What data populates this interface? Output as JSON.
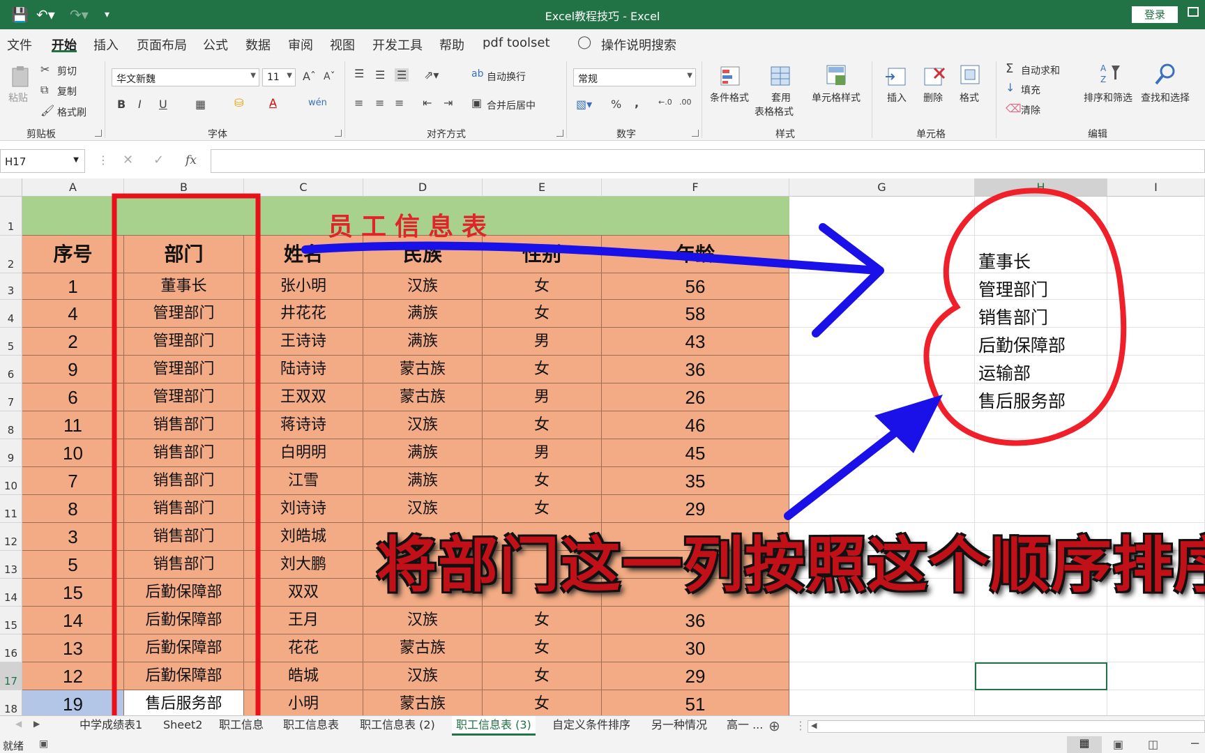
{
  "titlebar": {
    "title": "Excel教程技巧 - Excel",
    "login_label": "登录"
  },
  "menu": {
    "tabs": [
      "文件",
      "开始",
      "插入",
      "页面布局",
      "公式",
      "数据",
      "审阅",
      "视图",
      "开发工具",
      "帮助",
      "pdf toolset"
    ],
    "active": "开始",
    "search_label": "操作说明搜索"
  },
  "ribbon": {
    "clipboard": {
      "paste": "粘贴",
      "cut": "剪切",
      "copy": "复制",
      "painter": "格式刷",
      "group": "剪贴板"
    },
    "font": {
      "font_name": "华文新魏",
      "font_size": "11",
      "group": "字体"
    },
    "align": {
      "wrap": "自动换行",
      "merge": "合并后居中",
      "group": "对齐方式"
    },
    "number": {
      "format": "常规",
      "group": "数字"
    },
    "styles": {
      "cond": "条件格式",
      "table1": "套用",
      "table2": "表格格式",
      "cell": "单元格样式",
      "group": "样式"
    },
    "cells": {
      "insert": "插入",
      "delete": "删除",
      "format": "格式",
      "group": "单元格"
    },
    "editing": {
      "autosum": "自动求和",
      "fill": "填充",
      "clear": "清除",
      "sort": "排序和筛选",
      "find": "查找和选择",
      "group": "编辑"
    }
  },
  "formula_bar": {
    "name_box": "H17",
    "fx": "fx",
    "content": ""
  },
  "columns": [
    "A",
    "B",
    "C",
    "D",
    "E",
    "F",
    "G",
    "H",
    "I"
  ],
  "sheet": {
    "title": "员工信息表",
    "headers": [
      "序号",
      "部门",
      "姓名",
      "民族",
      "性别",
      "年龄"
    ],
    "rows": [
      [
        "1",
        "董事长",
        "张小明",
        "汉族",
        "女",
        "56"
      ],
      [
        "4",
        "管理部门",
        "井花花",
        "满族",
        "女",
        "58"
      ],
      [
        "2",
        "管理部门",
        "王诗诗",
        "满族",
        "男",
        "43"
      ],
      [
        "9",
        "管理部门",
        "陆诗诗",
        "蒙古族",
        "女",
        "36"
      ],
      [
        "6",
        "管理部门",
        "王双双",
        "蒙古族",
        "男",
        "26"
      ],
      [
        "11",
        "销售部门",
        "蒋诗诗",
        "汉族",
        "女",
        "46"
      ],
      [
        "10",
        "销售部门",
        "白明明",
        "满族",
        "男",
        "45"
      ],
      [
        "7",
        "销售部门",
        "江雪",
        "满族",
        "女",
        "35"
      ],
      [
        "8",
        "销售部门",
        "刘诗诗",
        "汉族",
        "女",
        "29"
      ],
      [
        "3",
        "销售部门",
        "刘皓城",
        "",
        "",
        ""
      ],
      [
        "5",
        "销售部门",
        "刘大鹏",
        "",
        "",
        ""
      ],
      [
        "15",
        "后勤保障部",
        "双双",
        "",
        "",
        ""
      ],
      [
        "14",
        "后勤保障部",
        "王月",
        "汉族",
        "女",
        "36"
      ],
      [
        "13",
        "后勤保障部",
        "花花",
        "蒙古族",
        "女",
        "30"
      ],
      [
        "12",
        "后勤保障部",
        "皓城",
        "汉族",
        "女",
        "29"
      ],
      [
        "19",
        "售后服务部",
        "小明",
        "蒙古族",
        "女",
        "51"
      ]
    ],
    "row_numbers": [
      "1",
      "2",
      "3",
      "4",
      "5",
      "6",
      "7",
      "8",
      "9",
      "10",
      "11",
      "12",
      "13",
      "14",
      "15",
      "16",
      "17",
      "18"
    ]
  },
  "custom_order": [
    "董事长",
    "管理部门",
    "销售部门",
    "后勤保障部",
    "运输部",
    "售后服务部"
  ],
  "caption": "将部门这一列按照这个顺序排序",
  "sheet_tabs": [
    "中学成绩表1",
    "Sheet2",
    "职工信息",
    "职工信息表",
    "职工信息表 (2)",
    "职工信息表 (3)",
    "自定义条件排序",
    "另一种情况",
    "高一 ..."
  ],
  "active_sheet": "职工信息表 (3)",
  "status": {
    "ready": "就绪"
  },
  "colors": {
    "excel_green": "#217346",
    "table_fill": "#f2ab84",
    "title_fill": "#a9d18e",
    "mark_red": "#e8101a",
    "mark_blue": "#1a10e8"
  }
}
